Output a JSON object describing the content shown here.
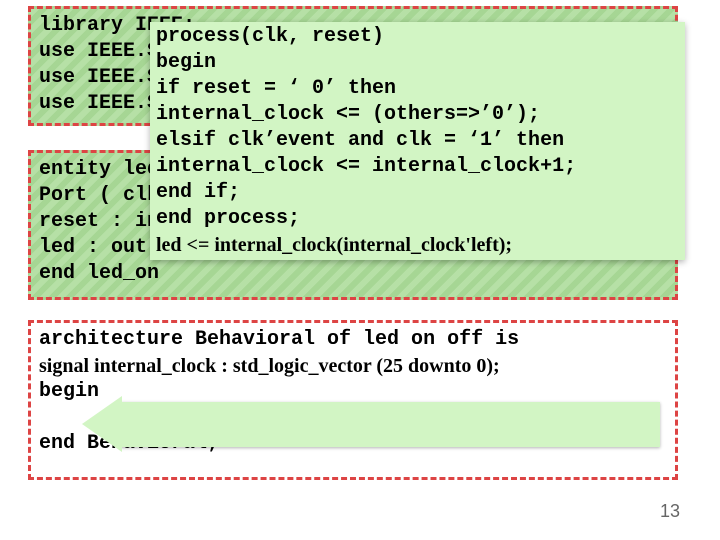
{
  "box1": {
    "l1": "library IEEE;",
    "l2": "use IEEE.ST",
    "l3": "use IEEE.ST",
    "l4": "use IEEE.ST"
  },
  "box2": {
    "l1": "entity led",
    "l2": "Port ( clk",
    "l3": "reset : in",
    "l4": "led : out s",
    "l5": "end led_on"
  },
  "box3": {
    "l1": "architecture Behavioral of led on off is",
    "l2": "signal internal_clock : std_logic_vector (25 downto 0);",
    "l3": "begin",
    "gap": " ",
    "l4": "end Behavioral;"
  },
  "overlay": {
    "l1": "process(clk, reset)",
    "l2": "begin",
    "l3": "if reset = ‘ 0’ then",
    "l4": "internal_clock <= (others=>’0’);",
    "l5": "elsif clk’event and clk = ‘1’ then",
    "l6": "internal_clock <= internal_clock+1;",
    "l7": "end if;",
    "l8": "end process;",
    "l9": "led <= internal_clock(internal_clock'left);"
  },
  "page": "13"
}
